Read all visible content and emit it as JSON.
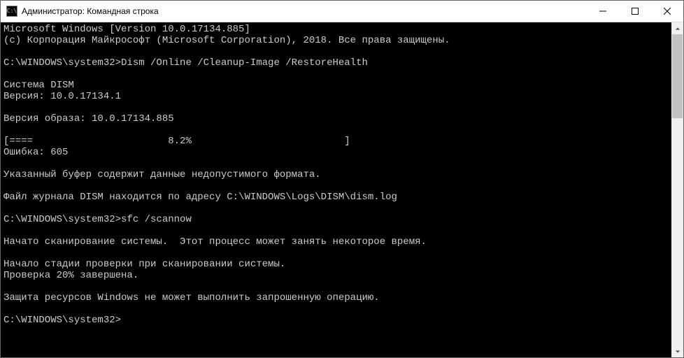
{
  "window": {
    "title": "Администратор: Командная строка",
    "app_icon_label": "C:\\"
  },
  "terminal": {
    "lines": [
      "Microsoft Windows [Version 10.0.17134.885]",
      "(c) Корпорация Майкрософт (Microsoft Corporation), 2018. Все права защищены.",
      "",
      "C:\\WINDOWS\\system32>Dism /Online /Cleanup-Image /RestoreHealth",
      "",
      "Cистема DISM",
      "Версия: 10.0.17134.1",
      "",
      "Версия образа: 10.0.17134.885",
      "",
      "[====                       8.2%                          ]",
      "Ошибка: 605",
      "",
      "Указанный буфер содержит данные недопустимого формата.",
      "",
      "Файл журнала DISM находится по адресу C:\\WINDOWS\\Logs\\DISM\\dism.log",
      "",
      "C:\\WINDOWS\\system32>sfc /scannow",
      "",
      "Начато сканирование системы.  Этот процесс может занять некоторое время.",
      "",
      "Начало стадии проверки при сканировании системы.",
      "Проверка 20% завершена.",
      "",
      "Защита ресурсов Windows не может выполнить запрошенную операцию.",
      "",
      "C:\\WINDOWS\\system32>"
    ]
  }
}
